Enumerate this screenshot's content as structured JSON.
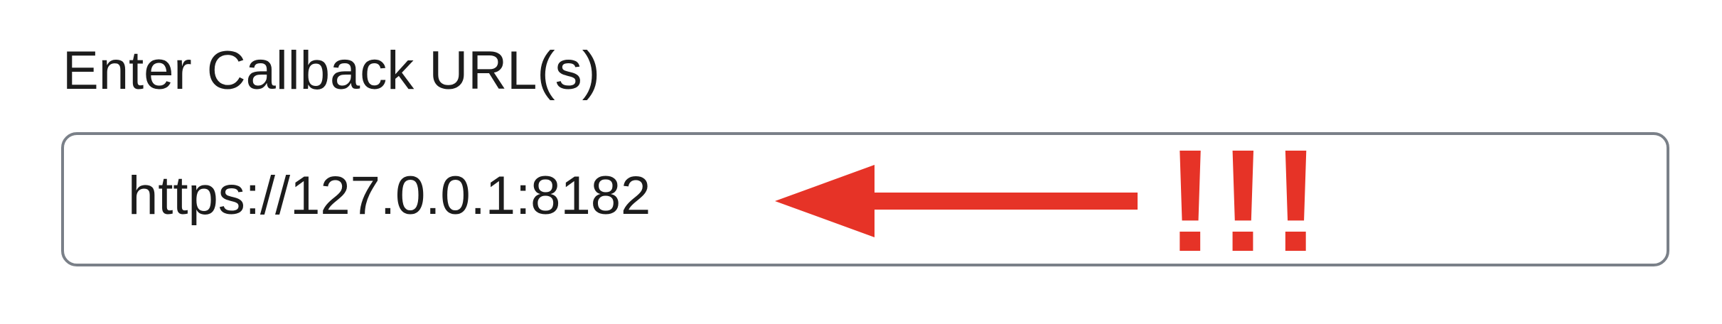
{
  "form": {
    "callback_label": "Enter Callback URL(s)",
    "callback_value": "https://127.0.0.1:8182"
  },
  "annotation": {
    "emphasis_text": "!!!",
    "color": "#e63327"
  }
}
